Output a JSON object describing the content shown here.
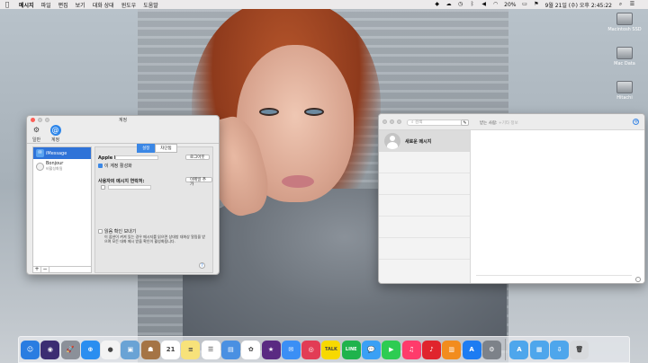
{
  "menubar": {
    "apple": "",
    "app": "메시지",
    "menus": [
      "파일",
      "편집",
      "보기",
      "대화 상대",
      "윈도우",
      "도움말"
    ],
    "battery": "20%",
    "clock": "9월 21일 (수) 오후 2:45:22"
  },
  "desktop_icons": [
    {
      "label": "Macintosh SSD"
    },
    {
      "label": "Mac Data"
    },
    {
      "label": "Hitachi"
    }
  ],
  "account_window": {
    "title": "계정",
    "tabs": [
      {
        "label": "일반"
      },
      {
        "label": "계정"
      }
    ],
    "accounts": [
      {
        "name": "iMessage",
        "sub": ""
      },
      {
        "name": "Bonjour",
        "sub": "비활성화됨"
      }
    ],
    "segments": [
      "설정",
      "차단됨"
    ],
    "apple_id_label": "Apple ID:",
    "signout": "로그아웃",
    "enable_label": "이 계정 활성화",
    "reach_label": "사용자의 메시지 연락처:",
    "add_email": "이메일 추가",
    "read_receipt": "읽음 확인 보내기",
    "read_note": "이 옵션이 켜져 있는 경우 메시지를 읽으면 상대방 대화상 알림을 받으며 모든 대화 메시 받을 확인이 활성화됩니다.",
    "help": "?"
  },
  "messages_window": {
    "search_placeholder": "검색",
    "compose": "✎",
    "to_label": "받는 사람:",
    "to_hint": "+기타 정보",
    "conversation": "새로운 메시지"
  },
  "dock": [
    {
      "name": "finder",
      "color": "#2a7de1",
      "glyph": "☺"
    },
    {
      "name": "siri",
      "color": "#3c2d72",
      "glyph": "◉"
    },
    {
      "name": "launchpad",
      "color": "#8b9099",
      "glyph": "🚀"
    },
    {
      "name": "safari",
      "color": "#2a8ef0",
      "glyph": "⊕"
    },
    {
      "name": "chrome",
      "color": "#f3f3f3",
      "glyph": "●"
    },
    {
      "name": "preview",
      "color": "#6aa3d5",
      "glyph": "▣"
    },
    {
      "name": "contacts",
      "color": "#a57445",
      "glyph": "☗"
    },
    {
      "name": "calendar",
      "color": "#ffffff",
      "glyph": "21"
    },
    {
      "name": "notes",
      "color": "#f7e27a",
      "glyph": "≡"
    },
    {
      "name": "reminders",
      "color": "#ffffff",
      "glyph": "☰"
    },
    {
      "name": "keynote",
      "color": "#4a90e2",
      "glyph": "▤"
    },
    {
      "name": "photos",
      "color": "#ffffff",
      "glyph": "✿"
    },
    {
      "name": "imovie",
      "color": "#5a2a82",
      "glyph": "★"
    },
    {
      "name": "mail",
      "color": "#3b8ff5",
      "glyph": "✉"
    },
    {
      "name": "photobooth",
      "color": "#e23c55",
      "glyph": "◎"
    },
    {
      "name": "kakaotalk",
      "color": "#f7d900",
      "glyph": "TALK"
    },
    {
      "name": "line",
      "color": "#1fb34c",
      "glyph": "LINE"
    },
    {
      "name": "messages",
      "color": "#3aa0f5",
      "glyph": "💬"
    },
    {
      "name": "facetime",
      "color": "#2ecc52",
      "glyph": "▶"
    },
    {
      "name": "itunes",
      "color": "#ff3b6b",
      "glyph": "♫"
    },
    {
      "name": "netease",
      "color": "#e0242d",
      "glyph": "♪"
    },
    {
      "name": "ibooks",
      "color": "#f28c1e",
      "glyph": "▥"
    },
    {
      "name": "appstore",
      "color": "#1d7cf2",
      "glyph": "A"
    },
    {
      "name": "system-preferences",
      "color": "#7d8289",
      "glyph": "⚙"
    },
    {
      "name": "applications-folder",
      "color": "#4ea6ec",
      "glyph": "A"
    },
    {
      "name": "documents-folder",
      "color": "#4ea6ec",
      "glyph": "▦"
    },
    {
      "name": "downloads-folder",
      "color": "#4ea6ec",
      "glyph": "⇩"
    },
    {
      "name": "trash",
      "color": "#d8dadd",
      "glyph": "🗑"
    }
  ]
}
